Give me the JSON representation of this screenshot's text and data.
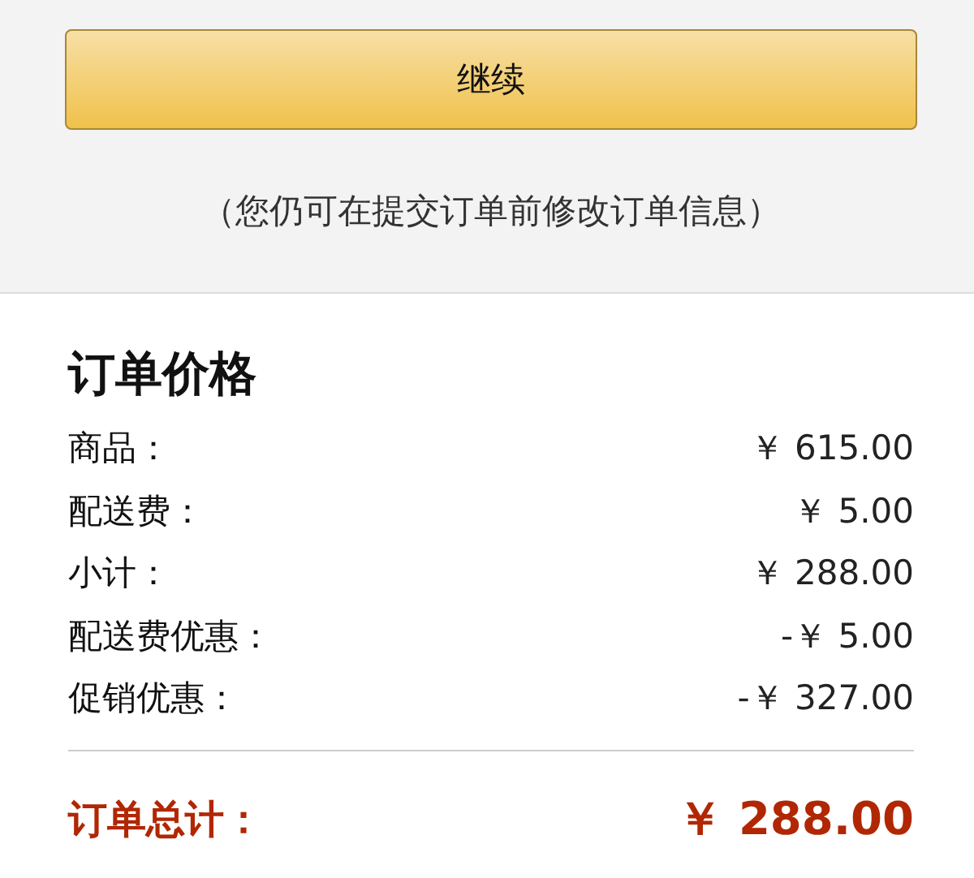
{
  "continue_button": {
    "label": "继续"
  },
  "note": "（您仍可在提交订单前修改订单信息）",
  "order_price": {
    "title": "订单价格",
    "rows": [
      {
        "label": "商品：",
        "value": "￥ 615.00"
      },
      {
        "label": "配送费：",
        "value": "￥ 5.00"
      },
      {
        "label": "小计：",
        "value": "￥ 288.00"
      },
      {
        "label": "配送费优惠：",
        "value": "-￥ 5.00"
      },
      {
        "label": "促销优惠：",
        "value": "-￥ 327.00"
      }
    ],
    "total": {
      "label": "订单总计：",
      "value": "￥ 288.00"
    }
  }
}
